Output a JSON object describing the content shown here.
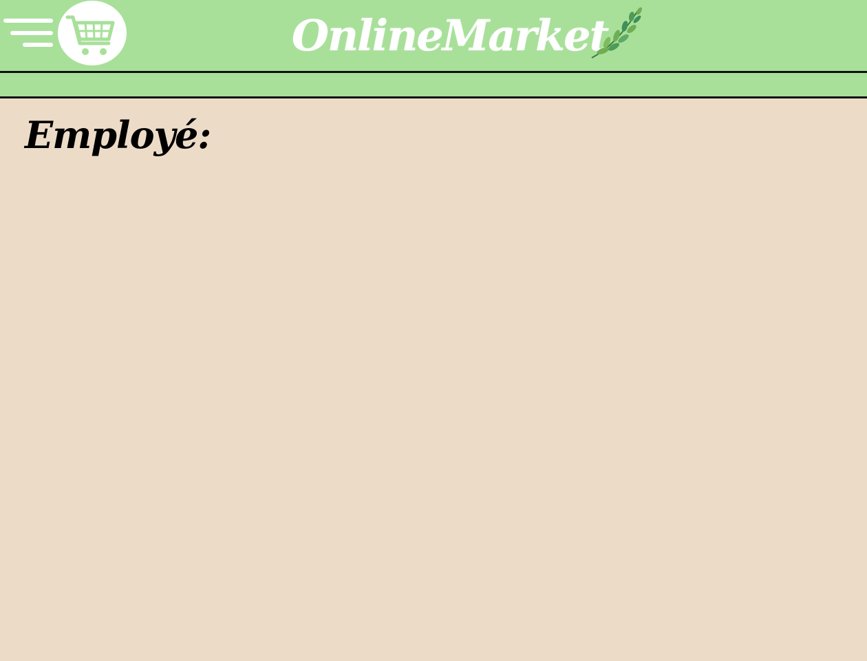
{
  "header": {
    "brand": "OnlineMarket",
    "menu_icon": "hamburger-menu-icon",
    "logo_icon": "shopping-cart-icon",
    "decoration_icon": "leaf-branch-icon"
  },
  "main": {
    "section_title": "Employé:"
  },
  "colors": {
    "header_bg": "#a8e09a",
    "page_bg": "#ecdcc7",
    "divider": "#111111",
    "brand_text": "#ffffff"
  }
}
